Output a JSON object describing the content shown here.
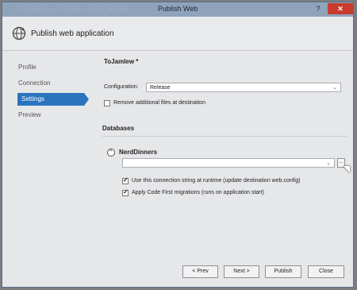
{
  "window": {
    "title": "Publish Web",
    "faded_tabs": "Ⓣ ConfigStore..  ..Explorer  ..Tools  ..Window",
    "help": "?",
    "close": "✕"
  },
  "header": {
    "title": "Publish web application",
    "icon": "globe-icon"
  },
  "sidebar": {
    "items": [
      {
        "label": "Profile"
      },
      {
        "label": "Connection"
      },
      {
        "label": "Settings",
        "active": true
      },
      {
        "label": "Preview"
      }
    ]
  },
  "main": {
    "profile_name": "ToJamlew *",
    "configuration_label": "Configuration:",
    "configuration_value": "Release",
    "remove_files_label": "Remove additional files at destination",
    "databases_heading": "Databases",
    "database_name": "NerdDinners",
    "connection_string_value": "",
    "use_connection_label": "Use this connection string at runtime (update destination web.config)",
    "apply_migrations_label": "Apply Code First migrations (runs on application start)",
    "ellipsis": "..."
  },
  "footer": {
    "prev": "< Prev",
    "next": "Next >",
    "publish": "Publish",
    "close": "Close"
  },
  "colors": {
    "accent": "#2a74be",
    "titlebar": "#8fa3bb",
    "close": "#c83b2d"
  }
}
